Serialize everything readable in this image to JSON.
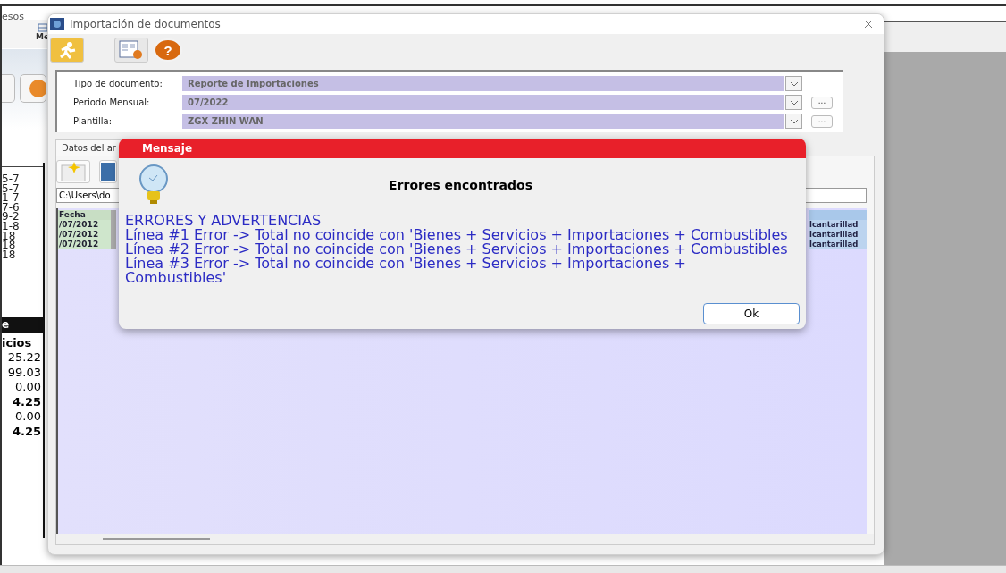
{
  "background_app": {
    "menu": [
      "esos"
    ],
    "toolbar_label": "Me",
    "column_1": [
      "5-7",
      "5-7",
      "1-7",
      "7-6",
      "9-2",
      "1-8",
      "18",
      "18",
      "18"
    ],
    "summary": {
      "header": "e",
      "subheader": "icios",
      "values": [
        {
          "text": "25.22",
          "kind": "normal"
        },
        {
          "text": "99.03",
          "kind": "normal"
        },
        {
          "text": "0.00",
          "kind": "normal"
        },
        {
          "text": "4.25",
          "kind": "total"
        },
        {
          "text": "0.00",
          "kind": "normal"
        },
        {
          "text": "4.25",
          "kind": "total"
        }
      ]
    }
  },
  "window": {
    "title": "Importación de documentos",
    "help_button": "?",
    "fields": [
      {
        "label": "Tipo de documento:",
        "value": "Reporte de Importaciones"
      },
      {
        "label": "Periodo Mensual:",
        "value": "07/2022",
        "more_button": "..."
      },
      {
        "label": "Plantilla:",
        "value": "ZGX ZHIN WAN",
        "more_button": "..."
      }
    ],
    "tabs": [
      {
        "label": "Datos del ar",
        "selected": true
      }
    ],
    "file_path": "C:\\Users\\do",
    "table": {
      "columns": [
        "Fecha"
      ],
      "rows": [
        {
          "date": "/07/2012",
          "last_column": "lcantarillad"
        },
        {
          "date": "/07/2012",
          "last_column": "lcantarillad"
        },
        {
          "date": "/07/2012",
          "last_column": "lcantarillad"
        }
      ]
    }
  },
  "message": {
    "title": "Mensaje",
    "heading": "Errores encontrados",
    "lines": [
      "ERRORES Y ADVERTENCIAS",
      "Línea #1 Error -> Total no coincide con 'Bienes + Servicios + Importaciones + Combustibles",
      "Línea #2 Error -> Total no coincide con 'Bienes + Servicios + Importaciones + Combustibles",
      "Línea #3 Error -> Total no coincide con 'Bienes + Servicios + Importaciones + Combustibles'"
    ],
    "button": "Ok"
  }
}
